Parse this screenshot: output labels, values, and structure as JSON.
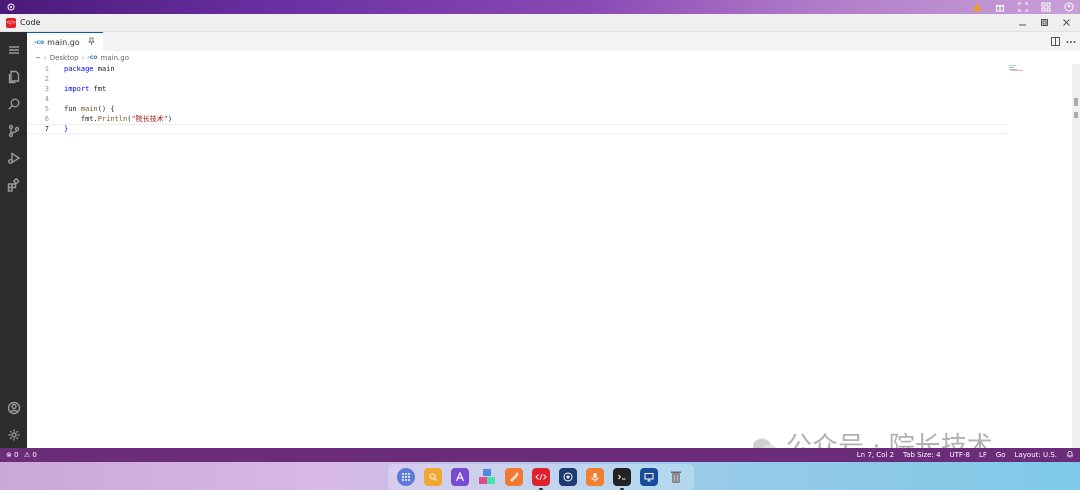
{
  "window": {
    "title": "Code"
  },
  "tab": {
    "label": "main.go",
    "icon_glyph": "-co"
  },
  "breadcrumb": {
    "home": "~",
    "folder": "Desktop",
    "file": "main.go"
  },
  "editor": {
    "lines": [
      {
        "num": "1",
        "text": "package main"
      },
      {
        "num": "2",
        "text": ""
      },
      {
        "num": "3",
        "text": "import fmt"
      },
      {
        "num": "4",
        "text": ""
      },
      {
        "num": "5",
        "text": "fun main() {"
      },
      {
        "num": "6",
        "text": "    fmt.Println(\"院长技术\")"
      },
      {
        "num": "7",
        "text": "}"
      }
    ],
    "active_line": 7
  },
  "status": {
    "errors": "0",
    "warnings": "0",
    "position": "Ln 7, Col 2",
    "tab_size": "Tab Size: 4",
    "encoding": "UTF-8",
    "eol": "LF",
    "language": "Go",
    "layout": "Layout: U.S."
  },
  "watermark": {
    "text": "公众号 · 院长技术"
  },
  "colors": {
    "status_bar": "#6b2c7a",
    "activity_bar": "#2c2c2c",
    "accent": "#005fb8",
    "logo": "#e0202a"
  }
}
